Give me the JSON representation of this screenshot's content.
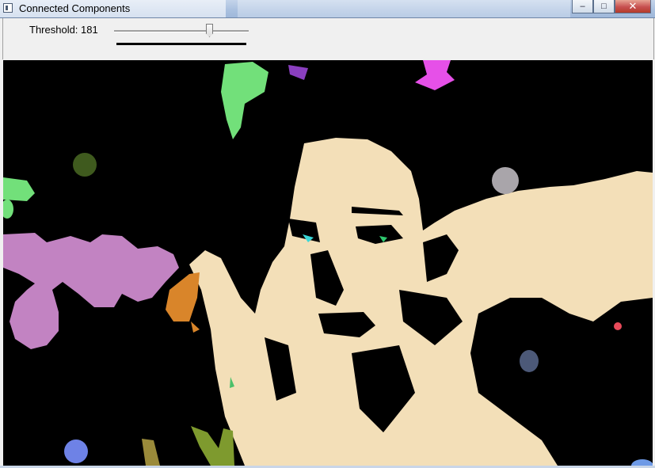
{
  "window": {
    "title": "Connected Components",
    "controls": {
      "minimize": "–",
      "maximize": "□",
      "close": "✕"
    }
  },
  "toolbar": {
    "threshold_label": "Threshold: 181",
    "threshold_value": 181
  },
  "image": {
    "description_hidden": "",
    "colors": {
      "background": "#000000",
      "face": "#f3dfb8",
      "green": "#72e07a",
      "magenta": "#e650e8",
      "olive": "#3f5a1e",
      "gray": "#a9a5aa",
      "pink": "#c283c2",
      "orange": "#d9852a",
      "slate": "#4c5978",
      "blue": "#6e82e6",
      "khaki": "#9a8a3a",
      "moss": "#7e9a2e",
      "cyan": "#3ad8d8",
      "red": "#e84a5a"
    }
  }
}
